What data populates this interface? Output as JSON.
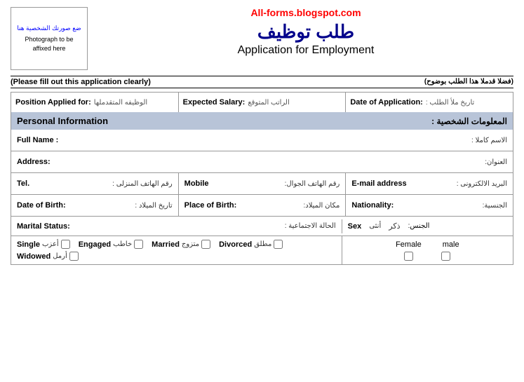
{
  "header": {
    "photo_arabic": "ضع صورتك الشخصية هنا",
    "photo_english": "Photograph to be\naffixed here",
    "site_url": "All-forms.blogspot.com",
    "arabic_title": "طلب توظيف",
    "english_title": "Application for Employment"
  },
  "instructions": {
    "english": "(Please fill out this application clearly)",
    "arabic": "(فضلا قدملا هذا الطلب بوضوح)"
  },
  "position_row": {
    "position_label": "Position Applied for:",
    "position_arabic": "الوظيفه المتقدملها",
    "salary_label": "Expected Salary:",
    "salary_arabic": "الراتب المتوقع",
    "date_label": "Date of Application:",
    "date_arabic": "تاريخ ملأ الطلب :"
  },
  "section_personal": {
    "label_en": "Personal Information",
    "label_ar": "المعلومات الشخصية :"
  },
  "fullname": {
    "label_en": "Full Name :",
    "label_ar": "الاسم كاملا :"
  },
  "address": {
    "label_en": "Address:",
    "label_ar": "العنوان:"
  },
  "tel": {
    "label_en": "Tel.",
    "label_ar": "رقم الهاتف المنزلى :",
    "mobile_en": "Mobile",
    "mobile_ar": "رقم الهاتف الجوال:",
    "email_en": "E-mail address",
    "email_ar": "البريد الالكترونى :"
  },
  "dob": {
    "label_en": "Date of Birth:",
    "label_ar": "تاريخ الميلاد :",
    "pob_en": "Place of Birth:",
    "pob_ar": "مكان الميلاد:",
    "nat_en": "Nationality:",
    "nat_ar": "الجنسية:"
  },
  "marital": {
    "label_en": "Marital Status:",
    "label_ar": "الحالة الاجتماعية :",
    "sex_en": "Sex",
    "sex_ar": "الجنس:",
    "female_en": "Female",
    "female_ar": "أنثى",
    "male_en": "male",
    "male_ar": "ذكر"
  },
  "marital_options": [
    {
      "en": "Single",
      "ar": "أعزب"
    },
    {
      "en": "Engaged",
      "ar": "خاطب"
    },
    {
      "en": "Married",
      "ar": "متزوج"
    },
    {
      "en": "Divorced",
      "ar": "مطلق"
    },
    {
      "en": "Widowed",
      "ar": "أرمل"
    }
  ]
}
